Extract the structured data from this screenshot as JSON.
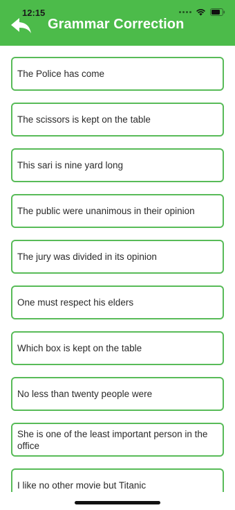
{
  "status_bar": {
    "time": "12:15"
  },
  "header": {
    "title": "Grammar Correction",
    "back_icon": "back-arrow-icon",
    "background_color": "#4cbb4a"
  },
  "items": [
    "The Police has come",
    "The scissors is kept on the table",
    "This sari is nine yard long",
    "The public were unanimous in their opinion",
    "The jury was divided in its opinion",
    "One must respect his elders",
    "Which box is kept on the table",
    "No less than twenty people were",
    "She is one of the least important person in the office",
    "I like no other movie but Titanic"
  ],
  "accent_border_color": "#58bb58"
}
